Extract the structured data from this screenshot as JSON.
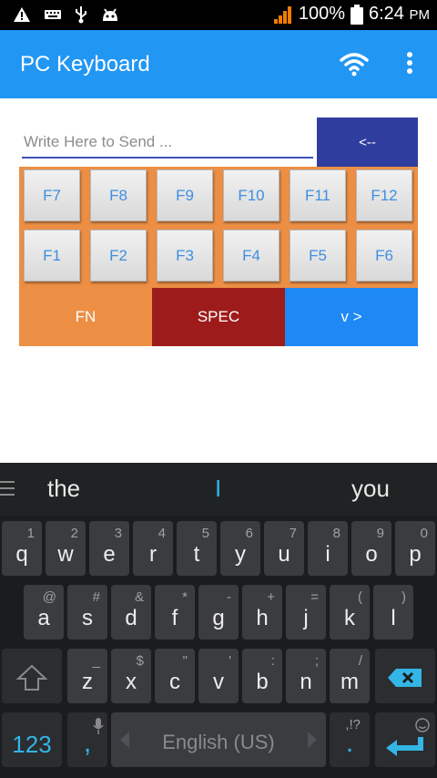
{
  "status_bar": {
    "battery": "100%",
    "time": "6:24",
    "time_suffix": "PM"
  },
  "app_bar": {
    "title": "PC Keyboard"
  },
  "send_row": {
    "placeholder": "Write Here to Send ...",
    "backspace_label": "<--"
  },
  "function_keys": {
    "row1": [
      "F7",
      "F8",
      "F9",
      "F10",
      "F11",
      "F12"
    ],
    "row2": [
      "F1",
      "F2",
      "F3",
      "F4",
      "F5",
      "F6"
    ]
  },
  "mode_buttons": {
    "fn": "FN",
    "spec": "SPEC",
    "next": "v >"
  },
  "colors": {
    "app_bar": "#2196f3",
    "send_button": "#2f3e9e",
    "panel": "#ec8f45",
    "fn_button": "#ec8f45",
    "spec_button": "#9e1b1b",
    "next_button": "#1e88f5",
    "fkey_text": "#3f8fe0",
    "keyboard_accent": "#33b5e5"
  },
  "soft_keyboard": {
    "suggestions": [
      "the",
      "I",
      "you"
    ],
    "row1": [
      {
        "key": "q",
        "hint": "1"
      },
      {
        "key": "w",
        "hint": "2"
      },
      {
        "key": "e",
        "hint": "3"
      },
      {
        "key": "r",
        "hint": "4"
      },
      {
        "key": "t",
        "hint": "5"
      },
      {
        "key": "y",
        "hint": "6"
      },
      {
        "key": "u",
        "hint": "7"
      },
      {
        "key": "i",
        "hint": "8"
      },
      {
        "key": "o",
        "hint": "9"
      },
      {
        "key": "p",
        "hint": "0"
      }
    ],
    "row2": [
      {
        "key": "a",
        "hint": "@"
      },
      {
        "key": "s",
        "hint": "#"
      },
      {
        "key": "d",
        "hint": "&"
      },
      {
        "key": "f",
        "hint": "*"
      },
      {
        "key": "g",
        "hint": "-"
      },
      {
        "key": "h",
        "hint": "+"
      },
      {
        "key": "j",
        "hint": "="
      },
      {
        "key": "k",
        "hint": "("
      },
      {
        "key": "l",
        "hint": ")"
      }
    ],
    "row3": [
      {
        "key": "z",
        "hint": "_"
      },
      {
        "key": "x",
        "hint": "$"
      },
      {
        "key": "c",
        "hint": "\""
      },
      {
        "key": "v",
        "hint": "'"
      },
      {
        "key": "b",
        "hint": ":"
      },
      {
        "key": "n",
        "hint": ";"
      },
      {
        "key": "m",
        "hint": "/"
      }
    ],
    "symbols_key": "123",
    "comma_key": ",",
    "period_key": ".",
    "period_hint": ",!?",
    "space_label": "English (US)"
  }
}
